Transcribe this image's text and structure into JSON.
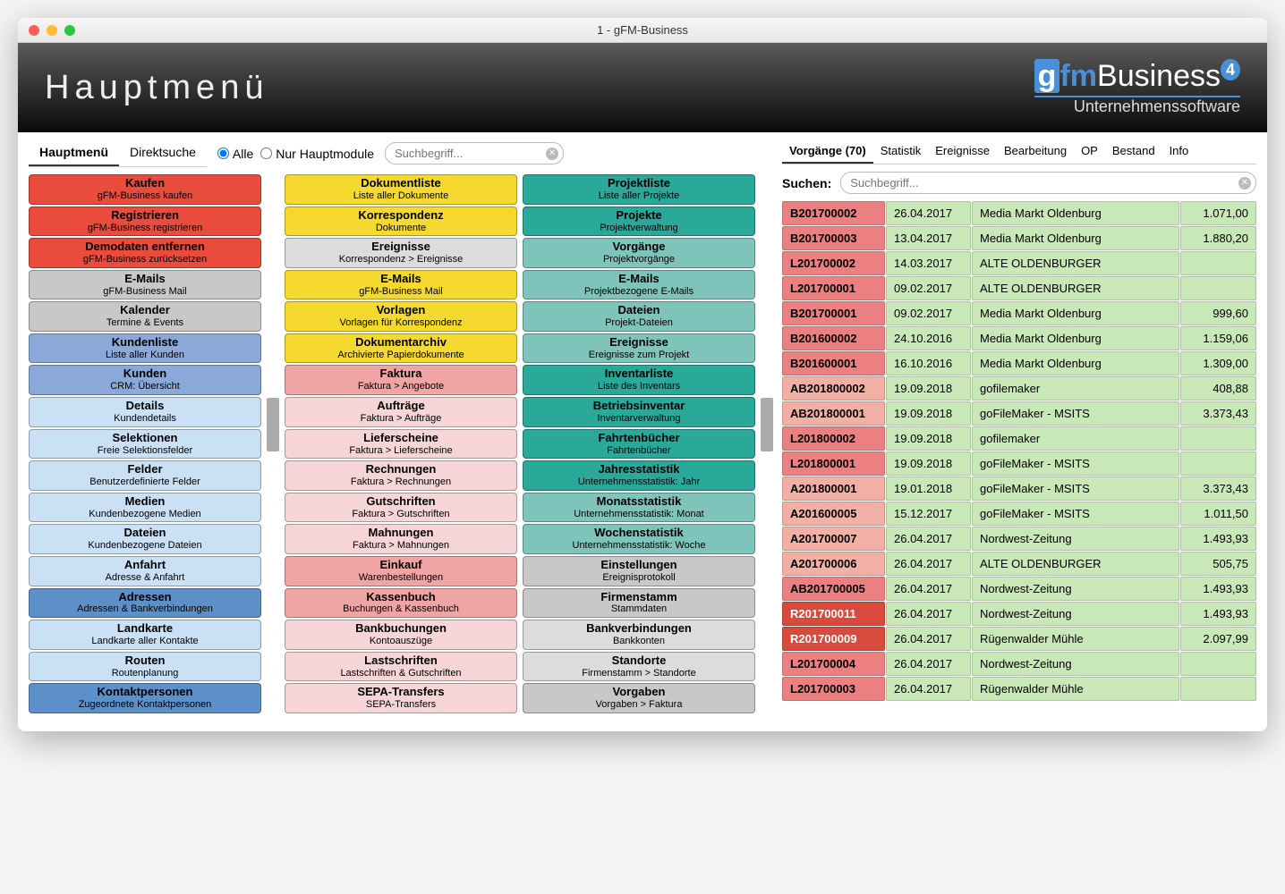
{
  "window_title": "1 - gFM-Business",
  "header_title": "Hauptmenü",
  "logo": {
    "brand_g": "g",
    "brand_fm": "fm",
    "brand_biz": "Business",
    "version": "4",
    "subtitle": "Unternehmenssoftware"
  },
  "left_tabs": [
    "Hauptmenü",
    "Direktsuche"
  ],
  "radios": {
    "all": "Alle",
    "main": "Nur Hauptmodule"
  },
  "search_placeholder": "Suchbegriff...",
  "col1": [
    {
      "t": "Kaufen",
      "s": "gFM-Business kaufen",
      "c": "c-red"
    },
    {
      "t": "Registrieren",
      "s": "gFM-Business registrieren",
      "c": "c-red"
    },
    {
      "t": "Demodaten entfernen",
      "s": "gFM-Business zurücksetzen",
      "c": "c-red"
    },
    {
      "t": "E-Mails",
      "s": "gFM-Business Mail",
      "c": "c-gray"
    },
    {
      "t": "Kalender",
      "s": "Termine & Events",
      "c": "c-gray"
    },
    {
      "t": "Kundenliste",
      "s": "Liste aller Kunden",
      "c": "c-bluehdr"
    },
    {
      "t": "Kunden",
      "s": "CRM: Übersicht",
      "c": "c-bluehdr"
    },
    {
      "t": "Details",
      "s": "Kundendetails",
      "c": "c-blue"
    },
    {
      "t": "Selektionen",
      "s": "Freie Selektionsfelder",
      "c": "c-blue"
    },
    {
      "t": "Felder",
      "s": "Benutzerdefinierte Felder",
      "c": "c-blue"
    },
    {
      "t": "Medien",
      "s": "Kundenbezogene Medien",
      "c": "c-blue"
    },
    {
      "t": "Dateien",
      "s": "Kundenbezogene Dateien",
      "c": "c-blue"
    },
    {
      "t": "Anfahrt",
      "s": "Adresse & Anfahrt",
      "c": "c-blue"
    },
    {
      "t": "Adressen",
      "s": "Adressen & Bankverbindungen",
      "c": "c-bluedk"
    },
    {
      "t": "Landkarte",
      "s": "Landkarte aller Kontakte",
      "c": "c-blue"
    },
    {
      "t": "Routen",
      "s": "Routenplanung",
      "c": "c-blue"
    },
    {
      "t": "Kontaktpersonen",
      "s": "Zugeordnete Kontaktpersonen",
      "c": "c-bluedk"
    }
  ],
  "col2": [
    {
      "t": "Dokumentliste",
      "s": "Liste aller Dokumente",
      "c": "c-yellow"
    },
    {
      "t": "Korrespondenz",
      "s": "Dokumente",
      "c": "c-yellow"
    },
    {
      "t": "Ereignisse",
      "s": "Korrespondenz > Ereignisse",
      "c": "c-grayl"
    },
    {
      "t": "E-Mails",
      "s": "gFM-Business Mail",
      "c": "c-yellow"
    },
    {
      "t": "Vorlagen",
      "s": "Vorlagen für Korrespondenz",
      "c": "c-yellow"
    },
    {
      "t": "Dokumentarchiv",
      "s": "Archivierte Papierdokumente",
      "c": "c-yellow"
    },
    {
      "t": "Faktura",
      "s": "Faktura > Angebote",
      "c": "c-pinkhdr"
    },
    {
      "t": "Aufträge",
      "s": "Faktura > Aufträge",
      "c": "c-pink"
    },
    {
      "t": "Lieferscheine",
      "s": "Faktura > Lieferscheine",
      "c": "c-pink"
    },
    {
      "t": "Rechnungen",
      "s": "Faktura > Rechnungen",
      "c": "c-pink"
    },
    {
      "t": "Gutschriften",
      "s": "Faktura > Gutschriften",
      "c": "c-pink"
    },
    {
      "t": "Mahnungen",
      "s": "Faktura > Mahnungen",
      "c": "c-pink"
    },
    {
      "t": "Einkauf",
      "s": "Warenbestellungen",
      "c": "c-pinkhdr"
    },
    {
      "t": "Kassenbuch",
      "s": "Buchungen & Kassenbuch",
      "c": "c-pinkhdr"
    },
    {
      "t": "Bankbuchungen",
      "s": "Kontoauszüge",
      "c": "c-pink"
    },
    {
      "t": "Lastschriften",
      "s": "Lastschriften & Gutschriften",
      "c": "c-pink"
    },
    {
      "t": "SEPA-Transfers",
      "s": "SEPA-Transfers",
      "c": "c-pink"
    }
  ],
  "col3": [
    {
      "t": "Projektliste",
      "s": "Liste aller Projekte",
      "c": "c-tealhdr"
    },
    {
      "t": "Projekte",
      "s": "Projektverwaltung",
      "c": "c-tealhdr"
    },
    {
      "t": "Vorgänge",
      "s": "Projektvorgänge",
      "c": "c-teal"
    },
    {
      "t": "E-Mails",
      "s": "Projektbezogene E-Mails",
      "c": "c-teal"
    },
    {
      "t": "Dateien",
      "s": "Projekt-Dateien",
      "c": "c-teal"
    },
    {
      "t": "Ereignisse",
      "s": "Ereignisse zum Projekt",
      "c": "c-teal"
    },
    {
      "t": "Inventarliste",
      "s": "Liste des Inventars",
      "c": "c-tealhdr"
    },
    {
      "t": "Betriebsinventar",
      "s": "Inventarverwaltung",
      "c": "c-tealhdr"
    },
    {
      "t": "Fahrtenbücher",
      "s": "Fahrtenbücher",
      "c": "c-tealhdr"
    },
    {
      "t": "Jahresstatistik",
      "s": "Unternehmensstatistik: Jahr",
      "c": "c-tealhdr"
    },
    {
      "t": "Monatsstatistik",
      "s": "Unternehmensstatistik: Monat",
      "c": "c-teal"
    },
    {
      "t": "Wochenstatistik",
      "s": "Unternehmensstatistik: Woche",
      "c": "c-teal"
    },
    {
      "t": "Einstellungen",
      "s": "Ereignisprotokoll",
      "c": "c-gray"
    },
    {
      "t": "Firmenstamm",
      "s": "Stammdaten",
      "c": "c-gray"
    },
    {
      "t": "Bankverbindungen",
      "s": "Bankkonten",
      "c": "c-grayl"
    },
    {
      "t": "Standorte",
      "s": "Firmenstamm > Standorte",
      "c": "c-grayl"
    },
    {
      "t": "Vorgaben",
      "s": "Vorgaben > Faktura",
      "c": "c-gray"
    }
  ],
  "right_tabs": [
    "Vorgänge (70)",
    "Statistik",
    "Ereignisse",
    "Bearbeitung",
    "OP",
    "Bestand",
    "Info"
  ],
  "search_label": "Suchen:",
  "rows": [
    {
      "id": "B201700002",
      "date": "26.04.2017",
      "name": "Media Markt Oldenburg",
      "amt": "1.071,00",
      "idc": "bg-red",
      "c": "bg-green"
    },
    {
      "id": "B201700003",
      "date": "13.04.2017",
      "name": "Media Markt Oldenburg",
      "amt": "1.880,20",
      "idc": "bg-red",
      "c": "bg-green"
    },
    {
      "id": "L201700002",
      "date": "14.03.2017",
      "name": "ALTE OLDENBURGER",
      "amt": "",
      "idc": "bg-red",
      "c": "bg-green"
    },
    {
      "id": "L201700001",
      "date": "09.02.2017",
      "name": "ALTE OLDENBURGER",
      "amt": "",
      "idc": "bg-red",
      "c": "bg-green"
    },
    {
      "id": "B201700001",
      "date": "09.02.2017",
      "name": "Media Markt Oldenburg",
      "amt": "999,60",
      "idc": "bg-red",
      "c": "bg-green"
    },
    {
      "id": "B201600002",
      "date": "24.10.2016",
      "name": "Media Markt Oldenburg",
      "amt": "1.159,06",
      "idc": "bg-red",
      "c": "bg-green"
    },
    {
      "id": "B201600001",
      "date": "16.10.2016",
      "name": "Media Markt Oldenburg",
      "amt": "1.309,00",
      "idc": "bg-red",
      "c": "bg-green"
    },
    {
      "id": "AB201800002",
      "date": "19.09.2018",
      "name": "gofilemaker",
      "amt": "408,88",
      "idc": "bg-pink",
      "c": "bg-green"
    },
    {
      "id": "AB201800001",
      "date": "19.09.2018",
      "name": "goFileMaker - MSITS",
      "amt": "3.373,43",
      "idc": "bg-pink",
      "c": "bg-green"
    },
    {
      "id": "L201800002",
      "date": "19.09.2018",
      "name": "gofilemaker",
      "amt": "",
      "idc": "bg-red",
      "c": "bg-green"
    },
    {
      "id": "L201800001",
      "date": "19.09.2018",
      "name": "goFileMaker - MSITS",
      "amt": "",
      "idc": "bg-red",
      "c": "bg-green"
    },
    {
      "id": "A201800001",
      "date": "19.01.2018",
      "name": "goFileMaker - MSITS",
      "amt": "3.373,43",
      "idc": "bg-pink",
      "c": "bg-green"
    },
    {
      "id": "A201600005",
      "date": "15.12.2017",
      "name": "goFileMaker - MSITS",
      "amt": "1.011,50",
      "idc": "bg-pink",
      "c": "bg-green"
    },
    {
      "id": "A201700007",
      "date": "26.04.2017",
      "name": "Nordwest-Zeitung",
      "amt": "1.493,93",
      "idc": "bg-pink",
      "c": "bg-green"
    },
    {
      "id": "A201700006",
      "date": "26.04.2017",
      "name": "ALTE OLDENBURGER",
      "amt": "505,75",
      "idc": "bg-pink",
      "c": "bg-green"
    },
    {
      "id": "AB201700005",
      "date": "26.04.2017",
      "name": "Nordwest-Zeitung",
      "amt": "1.493,93",
      "idc": "bg-red",
      "c": "bg-green"
    },
    {
      "id": "R201700011",
      "date": "26.04.2017",
      "name": "Nordwest-Zeitung",
      "amt": "1.493,93",
      "idc": "bg-reddk",
      "c": "bg-green"
    },
    {
      "id": "R201700009",
      "date": "26.04.2017",
      "name": "Rügenwalder Mühle",
      "amt": "2.097,99",
      "idc": "bg-reddk",
      "c": "bg-green"
    },
    {
      "id": "L201700004",
      "date": "26.04.2017",
      "name": "Nordwest-Zeitung",
      "amt": "",
      "idc": "bg-red",
      "c": "bg-green"
    },
    {
      "id": "L201700003",
      "date": "26.04.2017",
      "name": "Rügenwalder Mühle",
      "amt": "",
      "idc": "bg-red",
      "c": "bg-green"
    }
  ]
}
